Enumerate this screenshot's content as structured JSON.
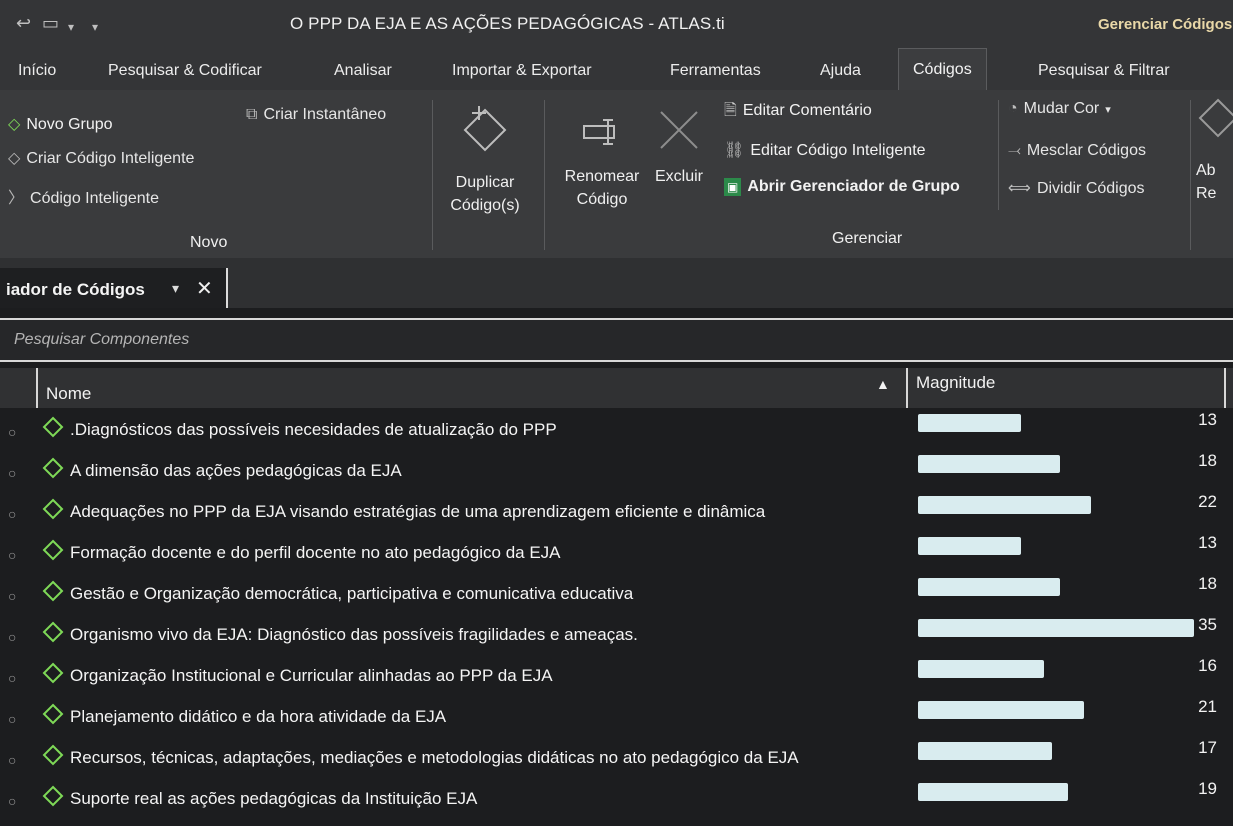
{
  "window": {
    "title": "O PPP DA EJA E AS AÇÕES PEDAGÓGICAS - ATLAS.ti",
    "context_title": "Gerenciar Códigos"
  },
  "menu": {
    "tabs": [
      "Início",
      "Pesquisar & Codificar",
      "Analisar",
      "Importar & Exportar",
      "Ferramentas",
      "Ajuda",
      "Códigos",
      "Pesquisar & Filtrar"
    ],
    "active_tab": "Códigos"
  },
  "ribbon": {
    "novo": {
      "novo_grupo": "Novo Grupo",
      "criar_codigo_inteligente": "Criar Código Inteligente",
      "codigo_inteligente": "Código Inteligente",
      "criar_instantaneo": "Criar Instantâneo",
      "group_label": "Novo"
    },
    "duplicar": [
      "Duplicar",
      "Código(s)"
    ],
    "renomear": [
      "Renomear",
      "Código"
    ],
    "excluir": "Excluir",
    "gerenciar": {
      "editar_comentario": "Editar Comentário",
      "editar_codigo_inteligente": "Editar Código Inteligente",
      "abrir_gerenciador_grupo": "Abrir Gerenciador de Grupo",
      "group_label": "Gerenciar"
    },
    "cor": {
      "mudar_cor": "Mudar Cor",
      "mesclar_codigos": "Mesclar Códigos",
      "dividir_codigos": "Dividir Códigos"
    },
    "partial_right": [
      "Ab",
      "Re"
    ]
  },
  "doc_tab": {
    "label": "iador de Códigos"
  },
  "search": {
    "placeholder": "Pesquisar Componentes"
  },
  "table": {
    "headers": {
      "name": "Nome",
      "magnitude": "Magnitude"
    },
    "max_magnitude": 35,
    "rows": [
      {
        "name": ".Diagnósticos das possíveis necesidades de atualização do PPP",
        "magnitude": 13
      },
      {
        "name": "A dimensão das ações pedagógicas da EJA",
        "magnitude": 18
      },
      {
        "name": "Adequações no PPP da EJA visando estratégias de uma aprendizagem eficiente e dinâmica",
        "magnitude": 22
      },
      {
        "name": "Formação docente e do perfil docente no ato pedagógico da EJA",
        "magnitude": 13
      },
      {
        "name": "Gestão e Organização democrática, participativa e comunicativa educativa",
        "magnitude": 18
      },
      {
        "name": "Organismo vivo da EJA: Diagnóstico das possíveis fragilidades e ameaças.",
        "magnitude": 35
      },
      {
        "name": "Organização Institucional e Curricular alinhadas ao PPP da EJA",
        "magnitude": 16
      },
      {
        "name": "Planejamento didático e da hora atividade da EJA",
        "magnitude": 21
      },
      {
        "name": "Recursos, técnicas, adaptações, mediações e metodologias didáticas no ato pedagógico da EJA",
        "magnitude": 17
      },
      {
        "name": "Suporte real as ações pedagógicas da Instituição EJA",
        "magnitude": 19
      }
    ]
  },
  "colors": {
    "code_icon": "#7ed957",
    "magnitude_bar": "#d9ecef",
    "context_title": "#e9d8a8"
  }
}
